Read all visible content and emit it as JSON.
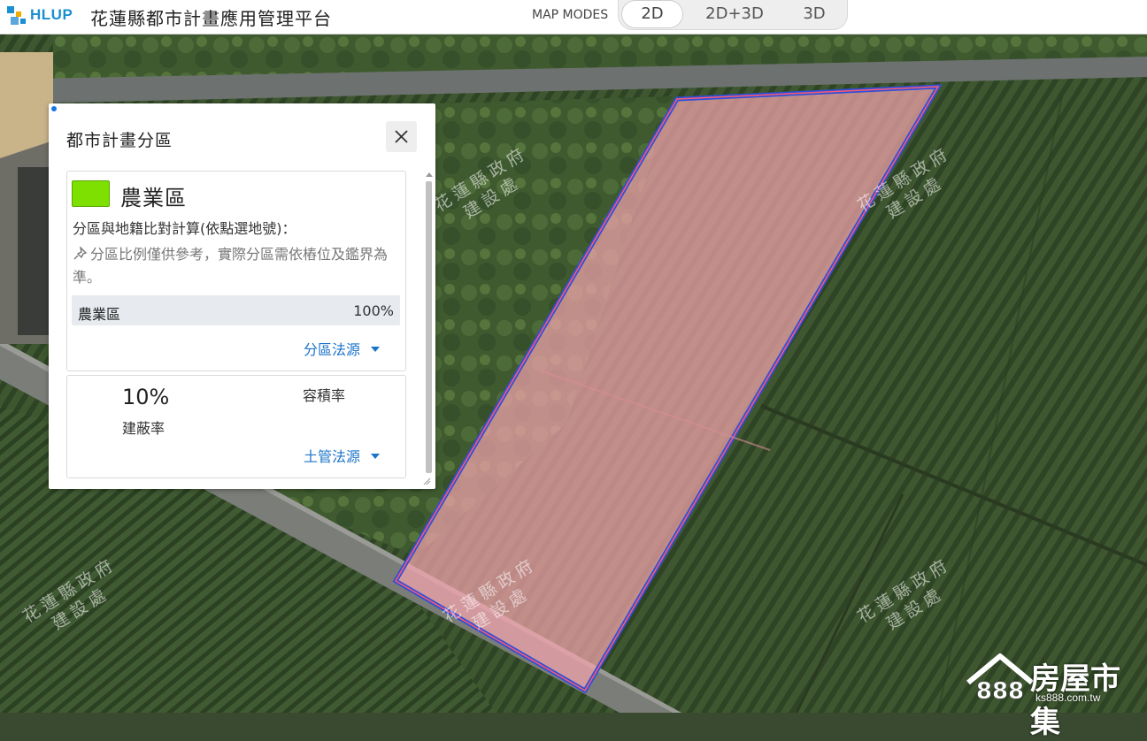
{
  "header": {
    "brand": "HLUP",
    "app_title": "花蓮縣都市計畫應用管理平台",
    "map_modes_label": "MAP MODES",
    "modes": [
      {
        "label": "2D",
        "active": true
      },
      {
        "label": "2D+3D",
        "active": false
      },
      {
        "label": "3D",
        "active": false
      }
    ]
  },
  "map": {
    "watermark_line1": "花蓮縣政府",
    "watermark_line2": "建設處",
    "parcel_fill_color": "#f4a3ad",
    "parcel_outline_color": "#2f4fd8"
  },
  "panel": {
    "title": "都市計畫分區",
    "close_icon": "close-icon",
    "zone": {
      "name": "農業區",
      "color": "#7ee000",
      "calc_text": "分區與地籍比對計算(依點選地號)：",
      "note": "分區比例僅供參考，實際分區需依樁位及鑑界為準。",
      "ratio": {
        "name": "農業區",
        "value": "100%"
      },
      "source_link": "分區法源"
    },
    "controls": {
      "coverage_value": "10%",
      "coverage_label": "建蔽率",
      "far_label": "容積率",
      "source_link": "土管法源"
    }
  },
  "corner_logo": {
    "brand": "房屋市集",
    "number": "888",
    "url": "ks888.com.tw"
  }
}
